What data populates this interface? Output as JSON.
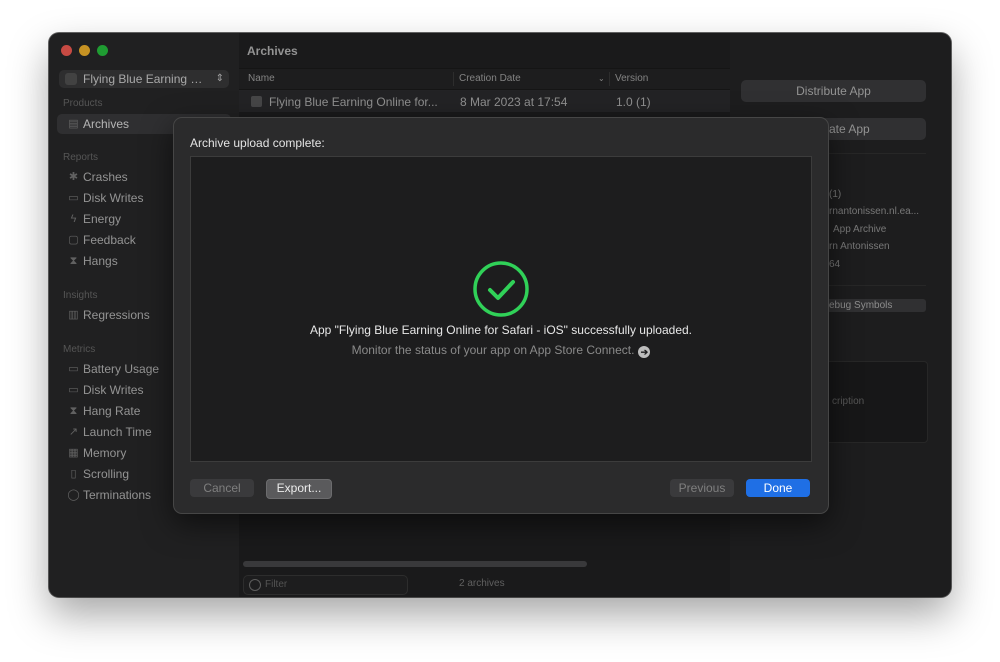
{
  "window": {
    "controls": [
      "close",
      "minimize",
      "maximize"
    ]
  },
  "sidebar": {
    "app_selector": {
      "label": "Flying Blue Earning On...",
      "icon": "app-icon",
      "chevron": "up-down-chevron-icon"
    },
    "sections": [
      {
        "title": "Products",
        "items": [
          {
            "label": "Archives",
            "icon": "archive-icon",
            "active": true
          }
        ]
      },
      {
        "title": "Reports",
        "items": [
          {
            "label": "Crashes",
            "icon": "crash-icon"
          },
          {
            "label": "Disk Writes",
            "icon": "disk-icon"
          },
          {
            "label": "Energy",
            "icon": "energy-icon"
          },
          {
            "label": "Feedback",
            "icon": "feedback-icon"
          },
          {
            "label": "Hangs",
            "icon": "hourglass-icon"
          }
        ]
      },
      {
        "title": "Insights",
        "items": [
          {
            "label": "Regressions",
            "icon": "regressions-icon"
          }
        ]
      },
      {
        "title": "Metrics",
        "items": [
          {
            "label": "Battery Usage",
            "icon": "battery-icon"
          },
          {
            "label": "Disk Writes",
            "icon": "disk-icon"
          },
          {
            "label": "Hang Rate",
            "icon": "hourglass-icon"
          },
          {
            "label": "Launch Time",
            "icon": "rocket-icon"
          },
          {
            "label": "Memory",
            "icon": "memory-icon"
          },
          {
            "label": "Scrolling",
            "icon": "scroll-icon"
          },
          {
            "label": "Terminations",
            "icon": "terminations-icon"
          }
        ]
      }
    ]
  },
  "archives": {
    "title": "Archives",
    "columns": {
      "name": "Name",
      "creation_date": "Creation Date",
      "version": "Version"
    },
    "rows": [
      {
        "name": "Flying Blue Earning Online for...",
        "creation_date": "8 Mar 2023 at 17:54",
        "version": "1.0 (1)"
      }
    ],
    "filter_placeholder": "Filter",
    "count": "2 archives"
  },
  "inspector": {
    "distribute_button": "Distribute App",
    "validate_button": "ate App",
    "details": [
      "(1)",
      "rnantonissen.nl.ea...",
      "App Archive",
      "rn Antonissen",
      "64"
    ],
    "debug_symbols_button": "ebug Symbols",
    "description_placeholder": "cription"
  },
  "dialog": {
    "title": "Archive upload complete:",
    "status_icon": "checkmark-circle-icon",
    "success_color": "#30d158",
    "message": "App \"Flying Blue Earning Online for Safari - iOS\" successfully uploaded.",
    "subtext": "Monitor the status of your app on App Store Connect.",
    "buttons": {
      "cancel": "Cancel",
      "export": "Export...",
      "previous": "Previous",
      "done": "Done"
    },
    "accent_color": "#1f6fe5"
  }
}
